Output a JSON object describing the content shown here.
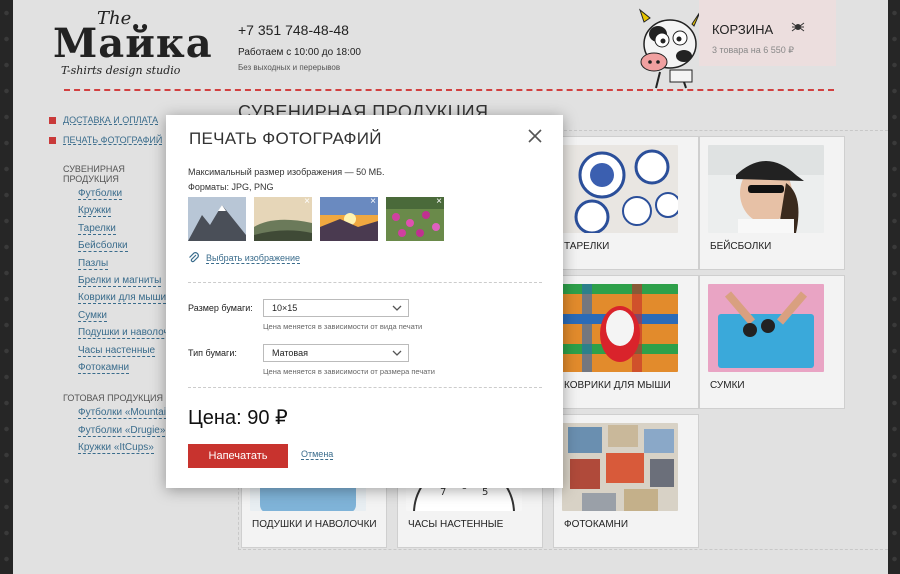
{
  "header": {
    "logo": {
      "the": "The",
      "main": "Майка",
      "sub": "T-shirts design studio"
    },
    "phone": "+7 351 748-48-48",
    "hours": "Работаем с 10:00 до 18:00",
    "hours_note": "Без выходных и перерывов",
    "cart": {
      "title": "КОРЗИНА",
      "summary": "3 товара на 6 550 ₽",
      "icon": "spider-icon"
    }
  },
  "sidebar": {
    "top_links": [
      "ДОСТАВКА И ОПЛАТА",
      "ПЕЧАТЬ ФОТОГРАФИЙ"
    ],
    "section1_title": "СУВЕНИРНАЯ ПРОДУКЦИЯ",
    "section1_items": [
      "Футболки",
      "Кружки",
      "Тарелки",
      "Бейсболки",
      "Пазлы",
      "Брелки и магниты",
      "Коврики для мыши",
      "Сумки",
      "Подушки и наволочки",
      "Часы настенные",
      "Фотокамни"
    ],
    "section2_title": "ГОТОВАЯ ПРОДУКЦИЯ",
    "section2_items": [
      "Футболки «Mountain»",
      "Футболки «Drugie»",
      "Кружки «ItCups»"
    ]
  },
  "main": {
    "title": "СУВЕНИРНАЯ ПРОДУКЦИЯ",
    "cards": [
      "ТАРЕЛКИ",
      "БЕЙСБОЛКИ",
      "КОВРИКИ ДЛЯ МЫШИ",
      "СУМКИ",
      "ПОДУШКИ И НАВОЛОЧКИ",
      "ЧАСЫ НАСТЕННЫЕ",
      "ФОТОКАМНИ"
    ]
  },
  "modal": {
    "title": "ПЕЧАТЬ ФОТОГРАФИЙ",
    "max_size": "Максимальный размер изображения — 50 МБ.",
    "formats": "Форматы: JPG, PNG",
    "choose_image": "Выбрать изображение",
    "paper_size_label": "Размер бумаги:",
    "paper_size_value": "10×15",
    "paper_size_hint": "Цена меняется в зависимости от вида печати",
    "paper_type_label": "Тип бумаги:",
    "paper_type_value": "Матовая",
    "paper_type_hint": "Цена меняется в зависимости от размера печати",
    "price": "Цена: 90 ₽",
    "print_button": "Напечатать",
    "cancel": "Отмена",
    "remove_mark": "×"
  },
  "colors": {
    "accent": "#c8332e",
    "link": "#3a6c8c",
    "background": "#e1e1e1",
    "cart_bg": "#ecdede"
  }
}
